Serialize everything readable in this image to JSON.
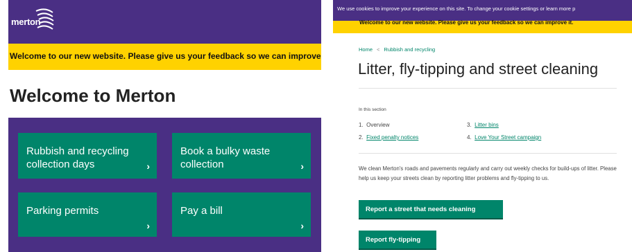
{
  "left": {
    "logo_text": "merton",
    "banner": "Welcome to our new website. Please give us your feedback so we can improve it.",
    "heading": "Welcome to Merton",
    "tiles": [
      {
        "label": "Rubbish and recycling collection days",
        "chevron": "›"
      },
      {
        "label": "Book a bulky waste collection",
        "chevron": "›"
      },
      {
        "label": "Parking permits",
        "chevron": "›"
      },
      {
        "label": "Pay a bill",
        "chevron": "›"
      }
    ]
  },
  "right": {
    "cookie": "We use cookies to improve your experience on this site. To change your cookie settings or learn more p",
    "banner": "Welcome to our new website. Please give us your feedback so we can improve it.",
    "breadcrumb": {
      "home": "Home",
      "separator": "<",
      "current": "Rubbish and recycling"
    },
    "title": "Litter, fly-tipping and street cleaning",
    "in_section": "In this section",
    "toc": [
      {
        "num": "1.",
        "label": "Overview"
      },
      {
        "num": "2.",
        "label": "Fixed penalty notices"
      },
      {
        "num": "3.",
        "label": "Litter bins"
      },
      {
        "num": "4.",
        "label": "Love Your Street campaign"
      }
    ],
    "description": "We clean Merton's roads and pavements regularly and carry out weekly checks for build-ups of litter. Please help us keep your streets clean by reporting litter problems and fly-tipping to us.",
    "buttons": {
      "report_street": "Report a street that needs cleaning",
      "report_flytipping": "Report fly-tipping"
    }
  },
  "colors": {
    "brand_purple": "#4a2f84",
    "banner_yellow": "#ffd200",
    "green": "#00856a"
  }
}
